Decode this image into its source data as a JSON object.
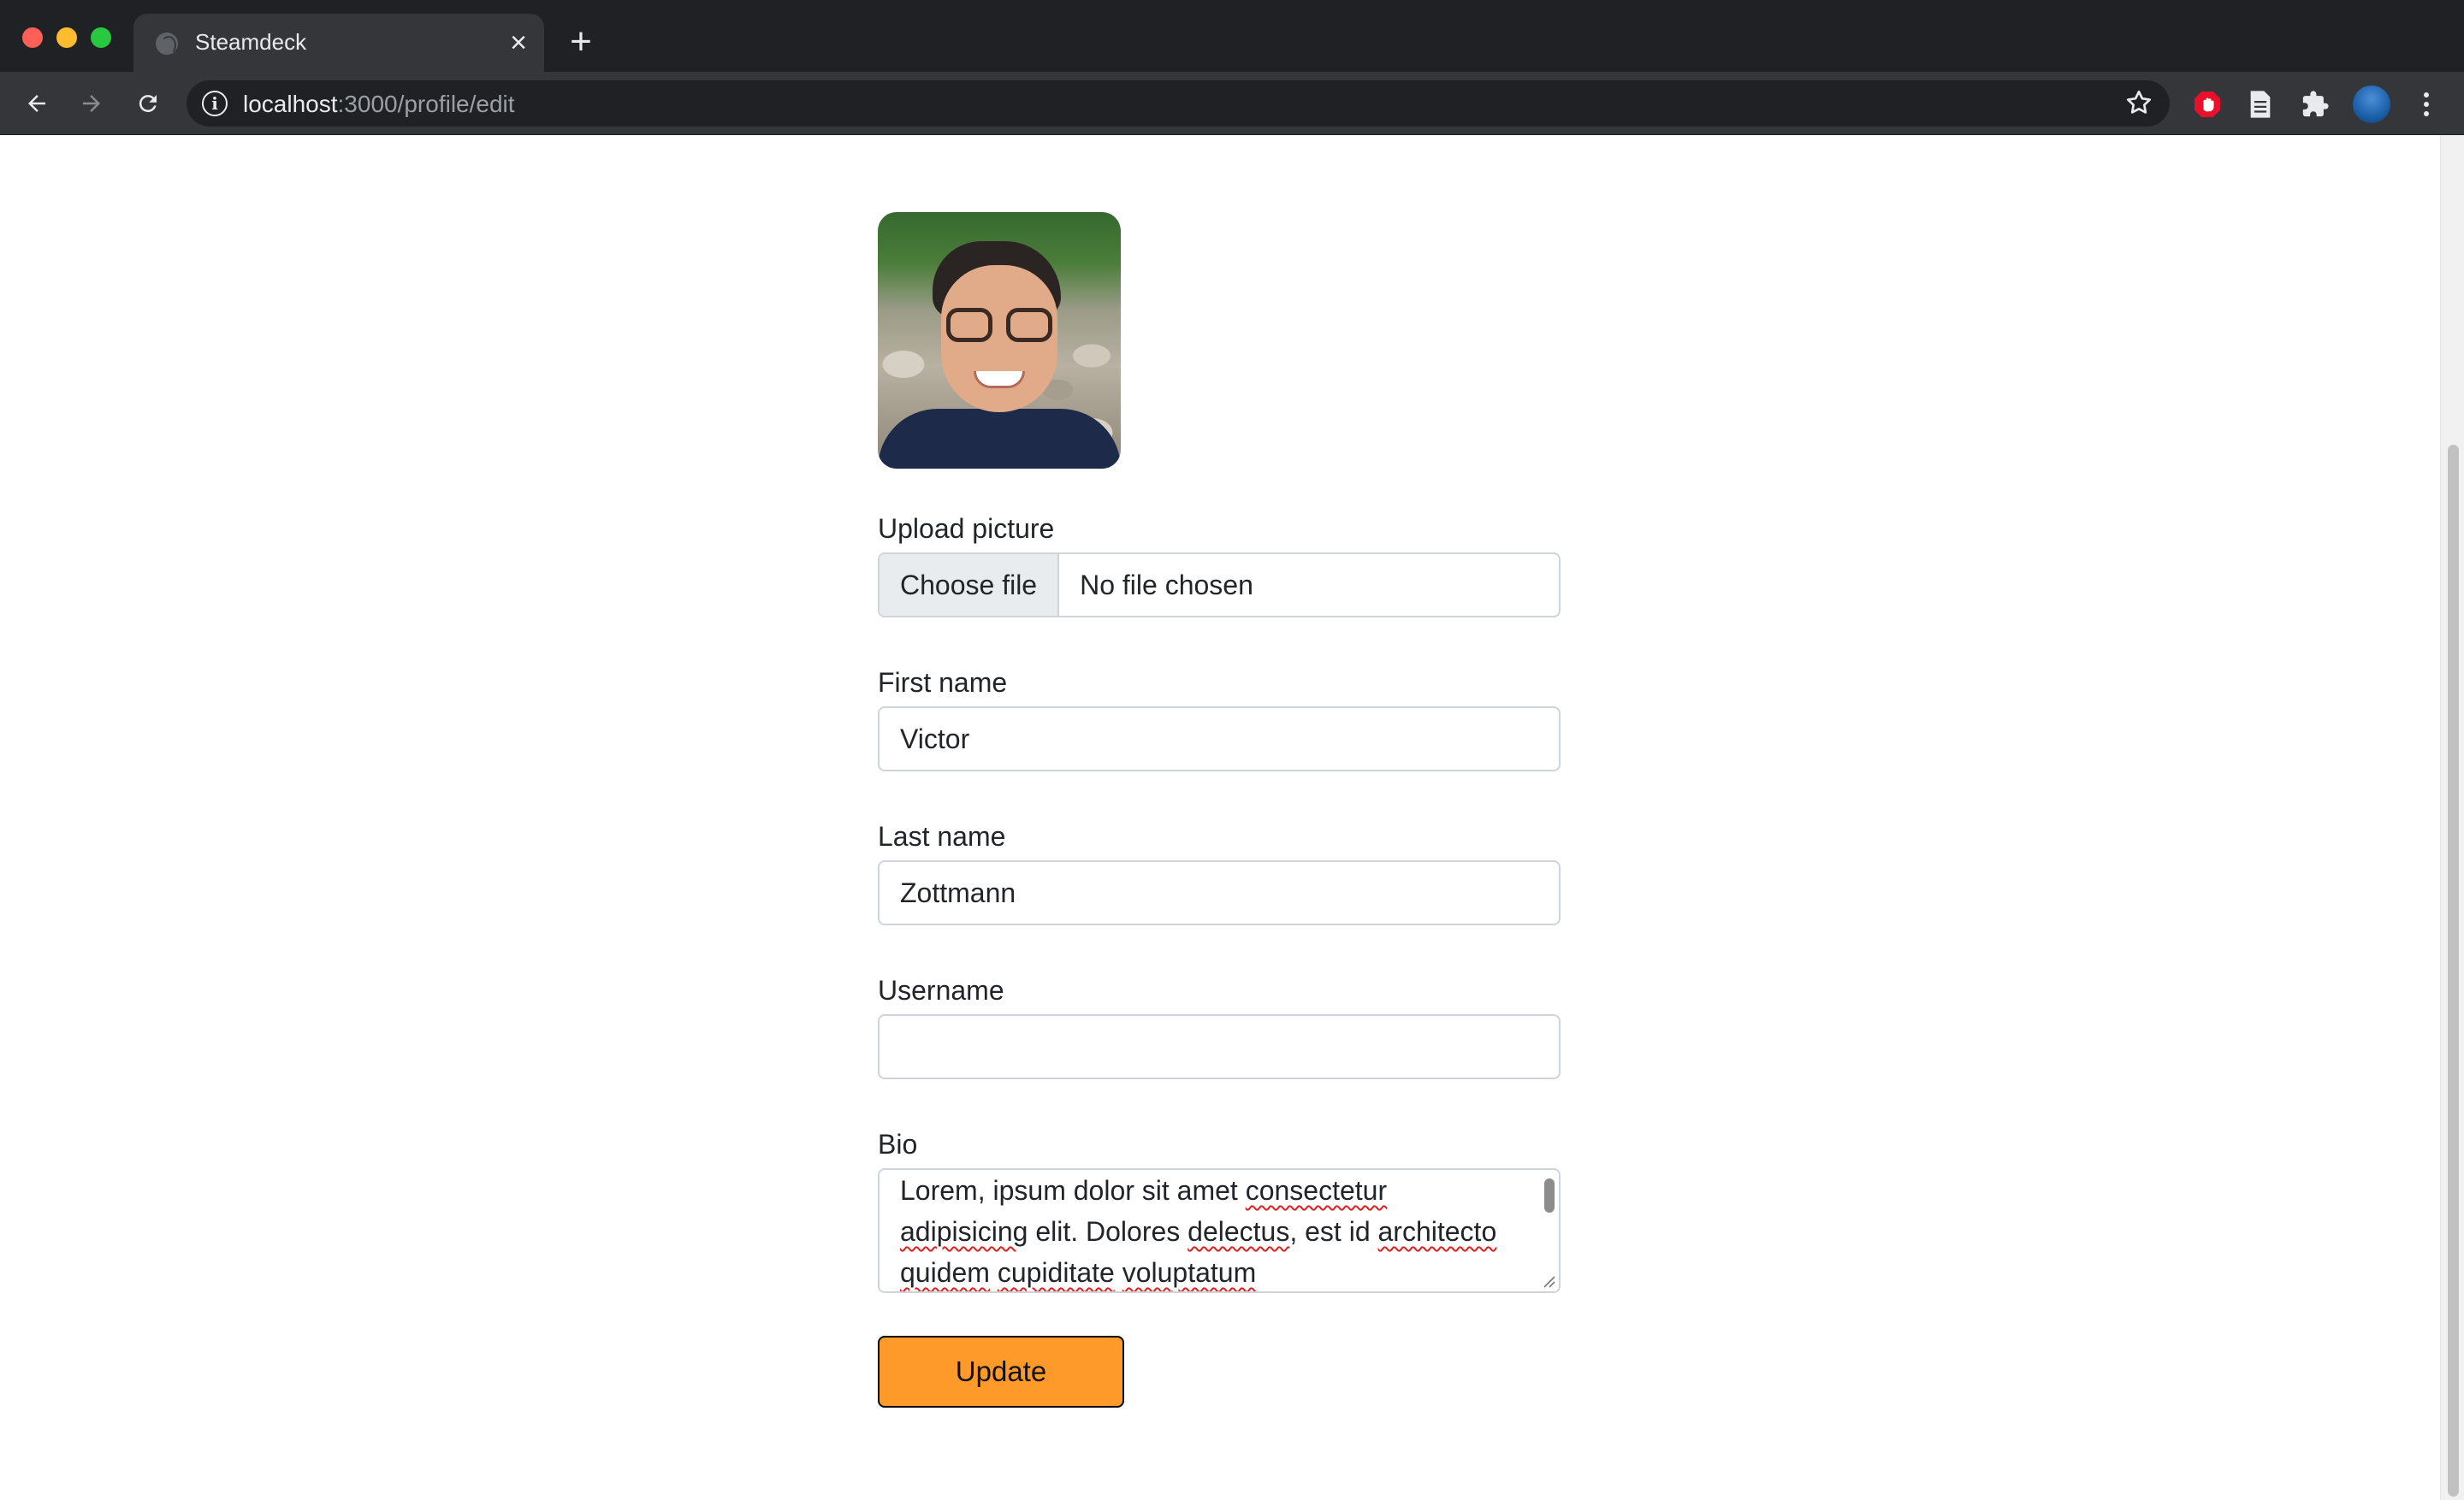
{
  "browser": {
    "tab_title": "Steamdeck",
    "url_host": "localhost",
    "url_path": ":3000/profile/edit"
  },
  "profile": {
    "photo_alt": "Profile picture"
  },
  "form": {
    "upload": {
      "label": "Upload picture",
      "button_label": "Choose file",
      "status": "No file chosen"
    },
    "first_name": {
      "label": "First name",
      "value": "Victor"
    },
    "last_name": {
      "label": "Last name",
      "value": "Zottmann"
    },
    "username": {
      "label": "Username",
      "value": ""
    },
    "bio": {
      "label": "Bio",
      "words": [
        "Lorem, ipsum dolor sit amet ",
        "consectetur",
        " ",
        "adipisicing",
        " elit. Dolores ",
        "delectus",
        ", est id ",
        "architecto",
        " ",
        "quidem",
        " ",
        "cupiditate",
        " ",
        "voluptatum"
      ]
    },
    "submit_label": "Update"
  },
  "icons": {
    "back": "arrow-left-icon",
    "forward": "arrow-right-icon",
    "reload": "reload-icon",
    "info": "info-icon",
    "star": "star-icon",
    "extensions": [
      "ad-block-icon",
      "document-icon",
      "puzzle-icon"
    ],
    "profile": "profile-avatar-icon",
    "menu": "kebab-menu-icon"
  },
  "colors": {
    "accent": "#fd9a2a",
    "chrome_dark": "#202124",
    "chrome_toolbar": "#35363a"
  }
}
